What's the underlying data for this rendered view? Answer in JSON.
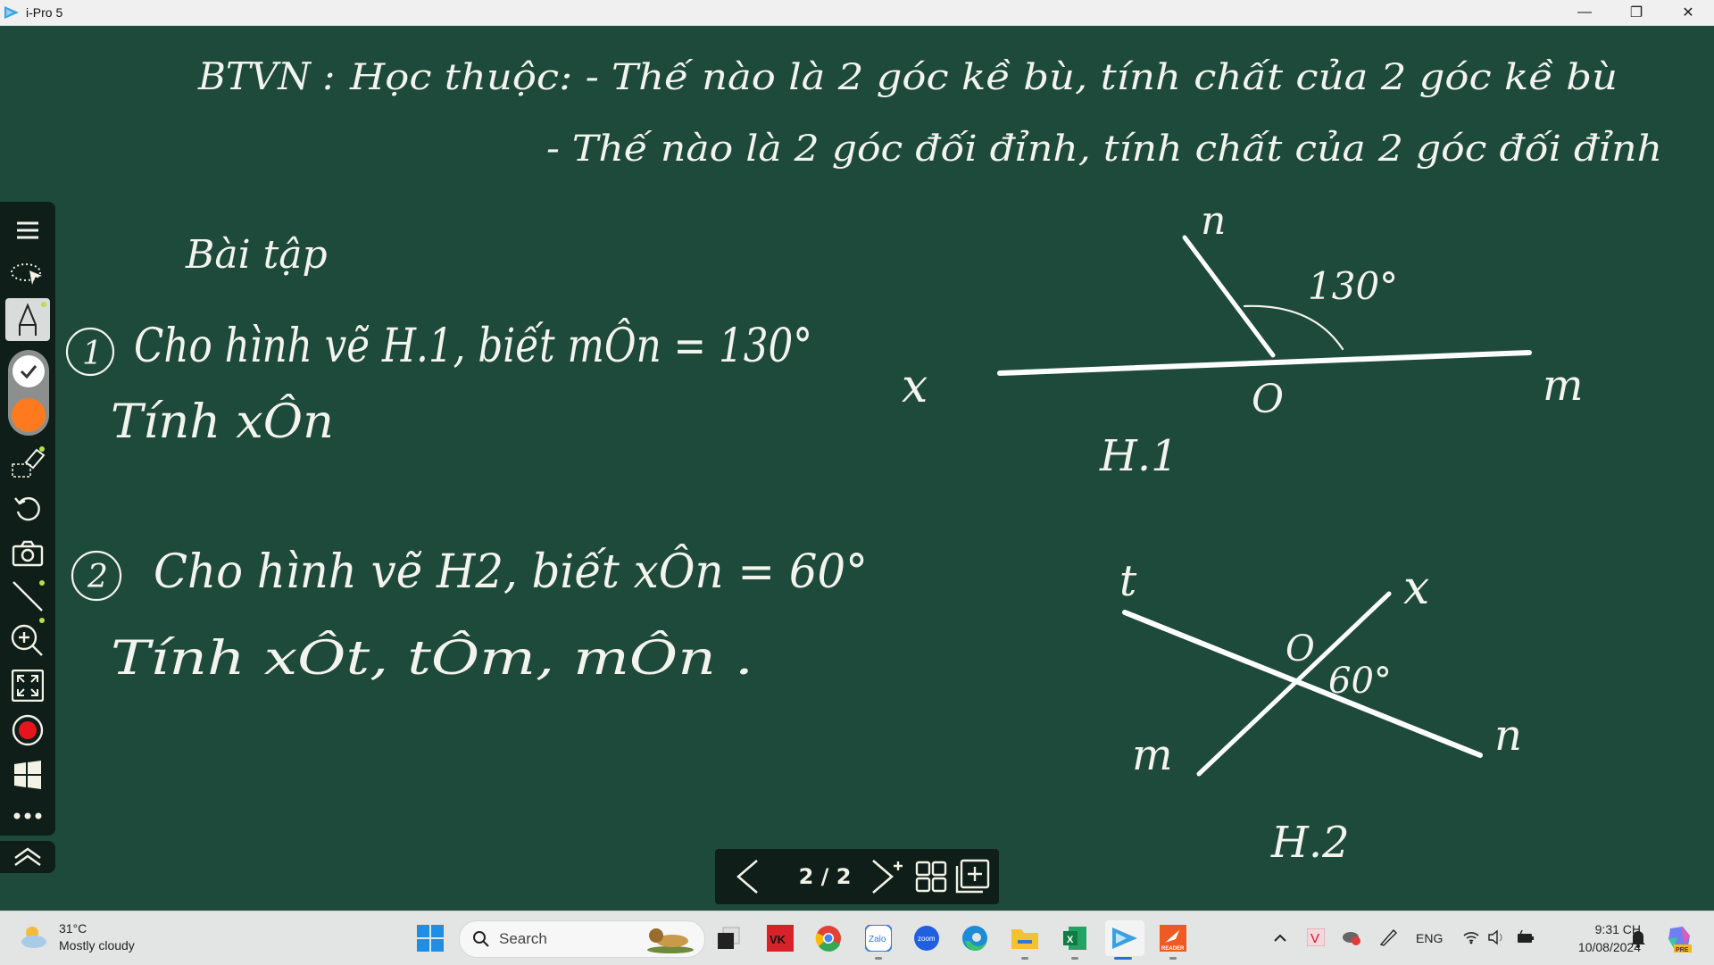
{
  "window": {
    "title": "i-Pro 5",
    "controls": {
      "minimize": "—",
      "restore": "❐",
      "close": "✕"
    }
  },
  "whiteboard": {
    "homework": {
      "label": "BTVN :",
      "line1": "Học thuộc: - Thế nào là 2 góc kề bù, tính chất của 2 góc kề bù",
      "line2": "- Thế nào là 2 góc đối đỉnh, tính chất của 2 góc đối đỉnh"
    },
    "exercises_heading": "Bài tập",
    "exercise1": {
      "number": "1",
      "line1": "Cho hình vẽ H.1, biết mÔn = 130°",
      "line2": "Tính xÔn"
    },
    "exercise2": {
      "number": "2",
      "line1": "Cho hình vẽ H2, biết xÔn = 60°",
      "line2": "Tính xÔt, tÔm, mÔn ."
    },
    "figure1": {
      "caption": "H.1",
      "labels": {
        "x": "x",
        "o": "O",
        "m": "m",
        "n": "n"
      },
      "angle_label": "130°"
    },
    "figure2": {
      "caption": "H.2",
      "labels": {
        "t": "t",
        "x": "x",
        "o": "O",
        "m": "m",
        "n": "n"
      },
      "angle_label": "60°"
    }
  },
  "toolbar": {
    "tools": [
      {
        "name": "menu",
        "icon": "hamburger-icon"
      },
      {
        "name": "select",
        "icon": "lasso-select-icon"
      },
      {
        "name": "pen",
        "icon": "pen-icon",
        "active": true
      },
      {
        "name": "color-white",
        "icon": "check-icon",
        "color": "#ffffff"
      },
      {
        "name": "color-orange",
        "icon": "color-swatch",
        "color": "#ff7a1f"
      },
      {
        "name": "eraser",
        "icon": "eraser-icon"
      },
      {
        "name": "undo",
        "icon": "undo-icon"
      },
      {
        "name": "screenshot",
        "icon": "camera-icon"
      },
      {
        "name": "line",
        "icon": "line-icon"
      },
      {
        "name": "zoom",
        "icon": "zoom-in-icon"
      },
      {
        "name": "fullscreen",
        "icon": "expand-icon"
      },
      {
        "name": "record",
        "icon": "record-icon",
        "color": "#e8141b"
      },
      {
        "name": "windows",
        "icon": "windows-icon"
      },
      {
        "name": "more",
        "icon": "more-icon"
      }
    ],
    "collapse": "chevron-up-icon"
  },
  "page_nav": {
    "current": "2",
    "total": "2",
    "display": "2 / 2"
  },
  "taskbar": {
    "weather": {
      "temp": "31°C",
      "condition": "Mostly cloudy"
    },
    "search_placeholder": "Search",
    "apps": [
      "Start",
      "Task View",
      "VK",
      "Chrome",
      "Zalo",
      "Zoom",
      "Edge",
      "File Explorer",
      "Excel",
      "i-Pro 5",
      "Reader"
    ],
    "tray": {
      "language": "ENG",
      "time": "9:31 CH",
      "date": "10/08/2024",
      "copilot_badge": "PRE"
    }
  }
}
